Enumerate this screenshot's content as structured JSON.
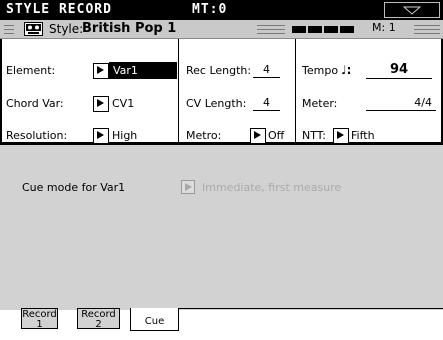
{
  "header": {
    "title": "STYLE RECORD",
    "mt": "MT:0",
    "menu_icon": "triangle-down-icon"
  },
  "style_bar": {
    "icon": "cassette-icon",
    "label": "Style:",
    "name": "British Pop 1",
    "measure": "M: 1"
  },
  "params": {
    "element": {
      "label": "Element:",
      "value": "Var1"
    },
    "chord_var": {
      "label": "Chord Var:",
      "value": "CV1"
    },
    "resolution": {
      "label": "Resolution:",
      "value": "High"
    },
    "rec_length": {
      "label": "Rec Length:",
      "value": "4"
    },
    "cv_length": {
      "label": "CV Length:",
      "value": "4"
    },
    "metro": {
      "label": "Metro:",
      "value": "Off"
    },
    "tempo": {
      "label": "Tempo",
      "note_symbol": "♩:",
      "value": "94"
    },
    "meter": {
      "label": "Meter:",
      "value": "4/4"
    },
    "ntt": {
      "label": "NTT:",
      "value": "Fifth"
    }
  },
  "cue": {
    "label": "Cue mode for Var1",
    "value": "Immediate, first measure"
  },
  "tabs": [
    {
      "line1": "Record",
      "line2": "1"
    },
    {
      "line1": "Record",
      "line2": "2"
    },
    {
      "line1": "Cue"
    }
  ]
}
